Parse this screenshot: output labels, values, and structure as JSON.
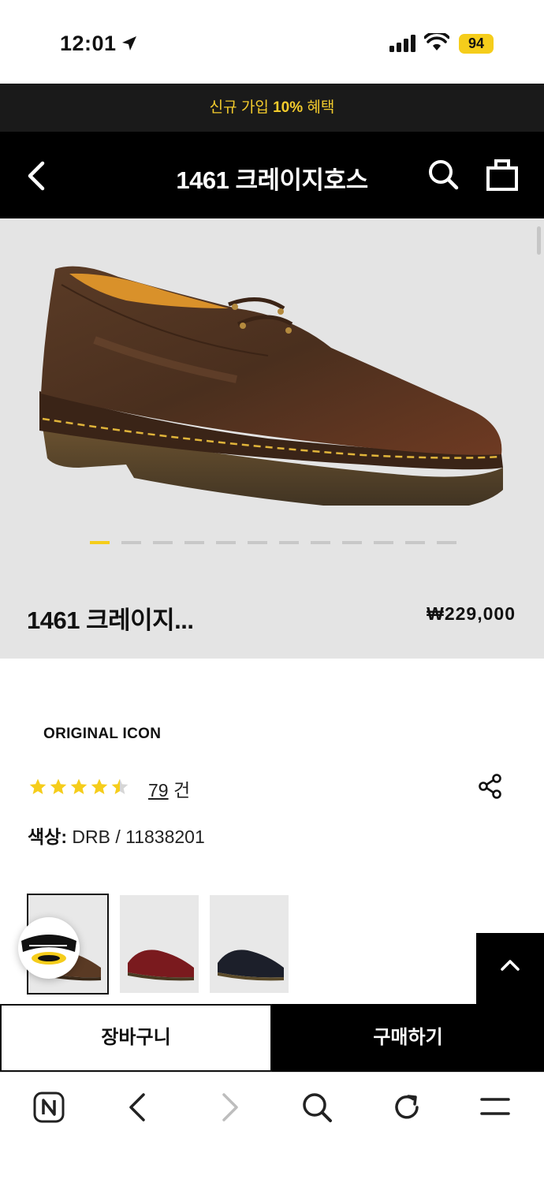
{
  "status": {
    "time": "12:01",
    "battery": "94"
  },
  "promo": {
    "prefix": "신규 가입 ",
    "highlight": "10%",
    "suffix": " 혜택"
  },
  "header": {
    "title": "1461 크레이지호스"
  },
  "gallery": {
    "image_count": 12,
    "active_index": 0
  },
  "product": {
    "name": "1461 크레이지...",
    "price": "₩229,000",
    "line": "ORIGINAL ICON",
    "rating": 4.5,
    "review_count": "79",
    "review_unit": " 건",
    "color_label": "색상:",
    "color_value": " DRB / 11838201"
  },
  "colors": {
    "accent": "#f5cd1b",
    "black": "#000000",
    "gallery_bg": "#e4e4e4"
  },
  "variants": [
    {
      "name": "brown",
      "selected": true
    },
    {
      "name": "cherry-red",
      "selected": false
    },
    {
      "name": "black",
      "selected": false
    }
  ],
  "actions": {
    "cart": "장바구니",
    "buy": "구매하기"
  }
}
